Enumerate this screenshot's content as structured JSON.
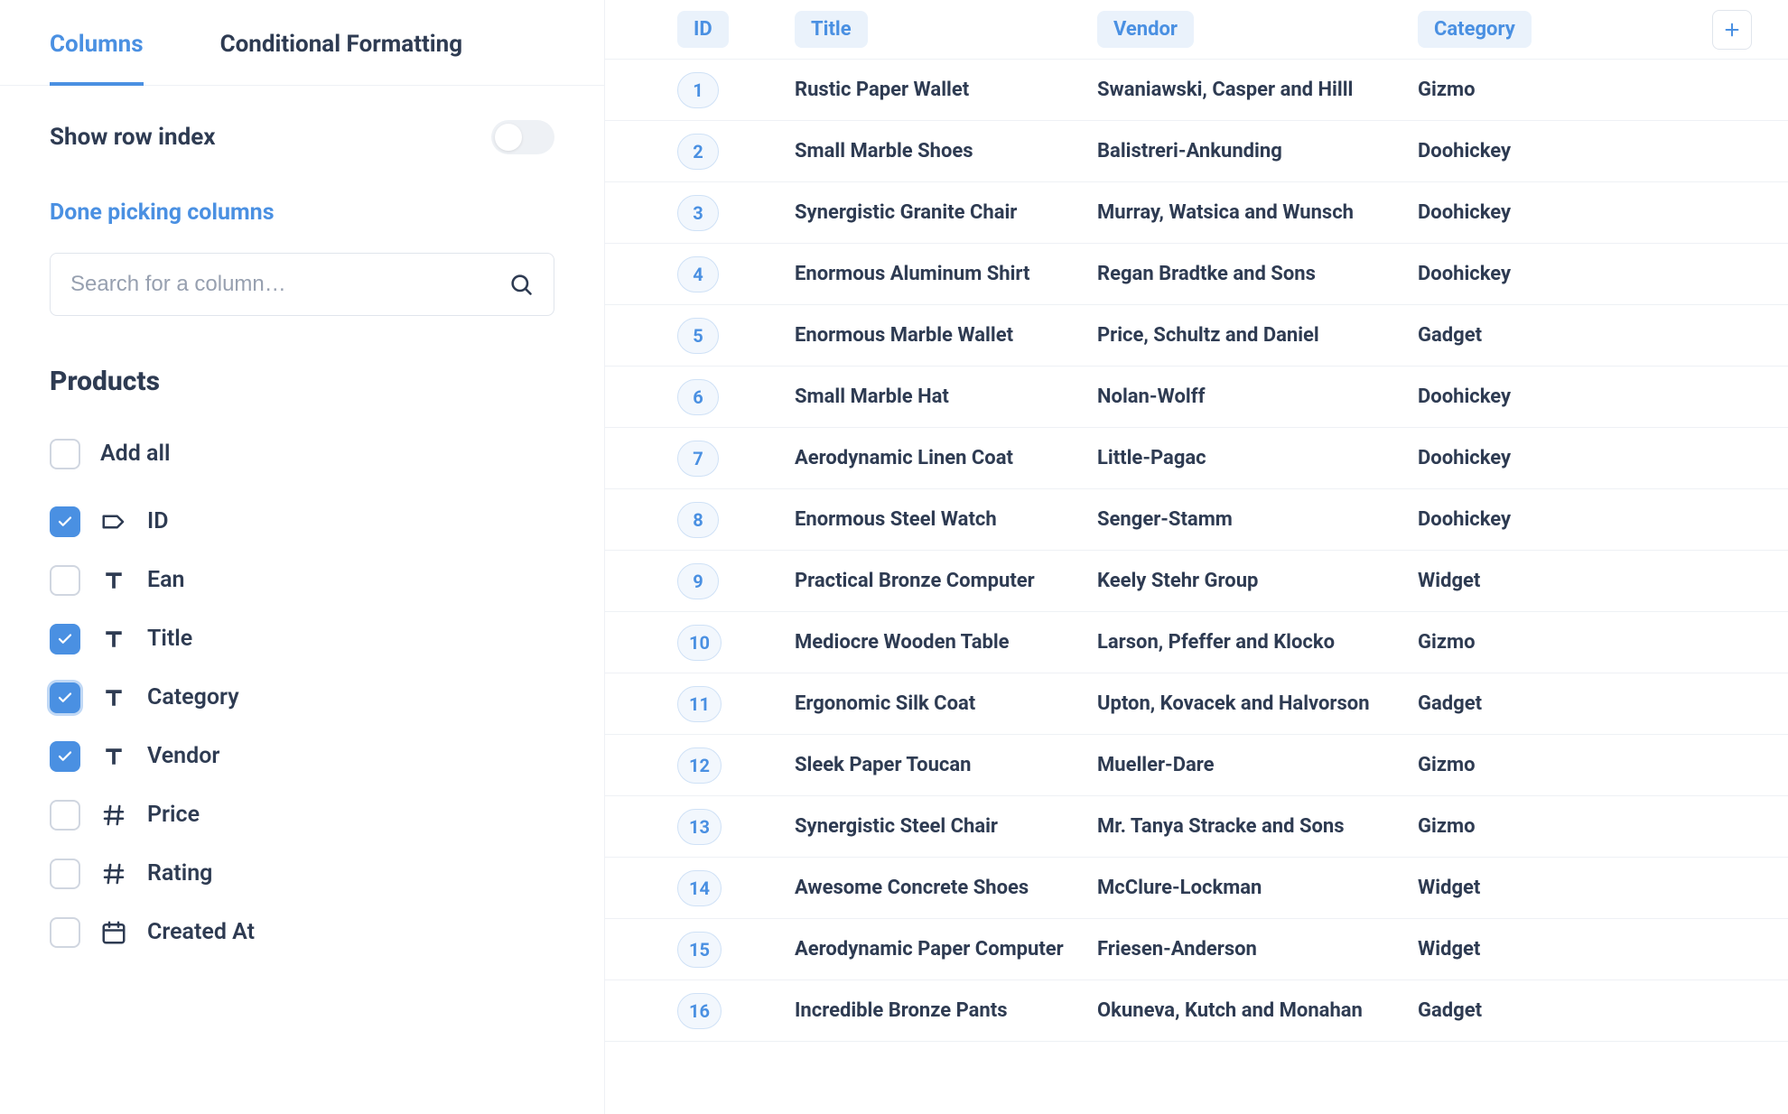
{
  "tabs": {
    "columns": "Columns",
    "conditional": "Conditional Formatting"
  },
  "showRowIndex": {
    "label": "Show row index",
    "value": false
  },
  "doneLink": "Done picking columns",
  "search": {
    "placeholder": "Search for a column…"
  },
  "group": {
    "title": "Products",
    "addAll": "Add all"
  },
  "columns": [
    {
      "label": "ID",
      "type": "label",
      "checked": true,
      "focus": false
    },
    {
      "label": "Ean",
      "type": "text",
      "checked": false,
      "focus": false
    },
    {
      "label": "Title",
      "type": "text",
      "checked": true,
      "focus": false
    },
    {
      "label": "Category",
      "type": "text",
      "checked": true,
      "focus": true
    },
    {
      "label": "Vendor",
      "type": "text",
      "checked": true,
      "focus": false
    },
    {
      "label": "Price",
      "type": "number",
      "checked": false,
      "focus": false
    },
    {
      "label": "Rating",
      "type": "number",
      "checked": false,
      "focus": false
    },
    {
      "label": "Created At",
      "type": "date",
      "checked": false,
      "focus": false
    }
  ],
  "table": {
    "headers": {
      "id": "ID",
      "title": "Title",
      "vendor": "Vendor",
      "category": "Category"
    },
    "rows": [
      {
        "id": "1",
        "title": "Rustic Paper Wallet",
        "vendor": "Swaniawski, Casper and Hilll",
        "category": "Gizmo"
      },
      {
        "id": "2",
        "title": "Small Marble Shoes",
        "vendor": "Balistreri-Ankunding",
        "category": "Doohickey"
      },
      {
        "id": "3",
        "title": "Synergistic Granite Chair",
        "vendor": "Murray, Watsica and Wunsch",
        "category": "Doohickey"
      },
      {
        "id": "4",
        "title": "Enormous Aluminum Shirt",
        "vendor": "Regan Bradtke and Sons",
        "category": "Doohickey"
      },
      {
        "id": "5",
        "title": "Enormous Marble Wallet",
        "vendor": "Price, Schultz and Daniel",
        "category": "Gadget"
      },
      {
        "id": "6",
        "title": "Small Marble Hat",
        "vendor": "Nolan-Wolff",
        "category": "Doohickey"
      },
      {
        "id": "7",
        "title": "Aerodynamic Linen Coat",
        "vendor": "Little-Pagac",
        "category": "Doohickey"
      },
      {
        "id": "8",
        "title": "Enormous Steel Watch",
        "vendor": "Senger-Stamm",
        "category": "Doohickey"
      },
      {
        "id": "9",
        "title": "Practical Bronze Computer",
        "vendor": "Keely Stehr Group",
        "category": "Widget"
      },
      {
        "id": "10",
        "title": "Mediocre Wooden Table",
        "vendor": "Larson, Pfeffer and Klocko",
        "category": "Gizmo"
      },
      {
        "id": "11",
        "title": "Ergonomic Silk Coat",
        "vendor": "Upton, Kovacek and Halvorson",
        "category": "Gadget"
      },
      {
        "id": "12",
        "title": "Sleek Paper Toucan",
        "vendor": "Mueller-Dare",
        "category": "Gizmo"
      },
      {
        "id": "13",
        "title": "Synergistic Steel Chair",
        "vendor": "Mr. Tanya Stracke and Sons",
        "category": "Gizmo"
      },
      {
        "id": "14",
        "title": "Awesome Concrete Shoes",
        "vendor": "McClure-Lockman",
        "category": "Widget"
      },
      {
        "id": "15",
        "title": "Aerodynamic Paper Computer",
        "vendor": "Friesen-Anderson",
        "category": "Widget"
      },
      {
        "id": "16",
        "title": "Incredible Bronze Pants",
        "vendor": "Okuneva, Kutch and Monahan",
        "category": "Gadget"
      }
    ]
  }
}
